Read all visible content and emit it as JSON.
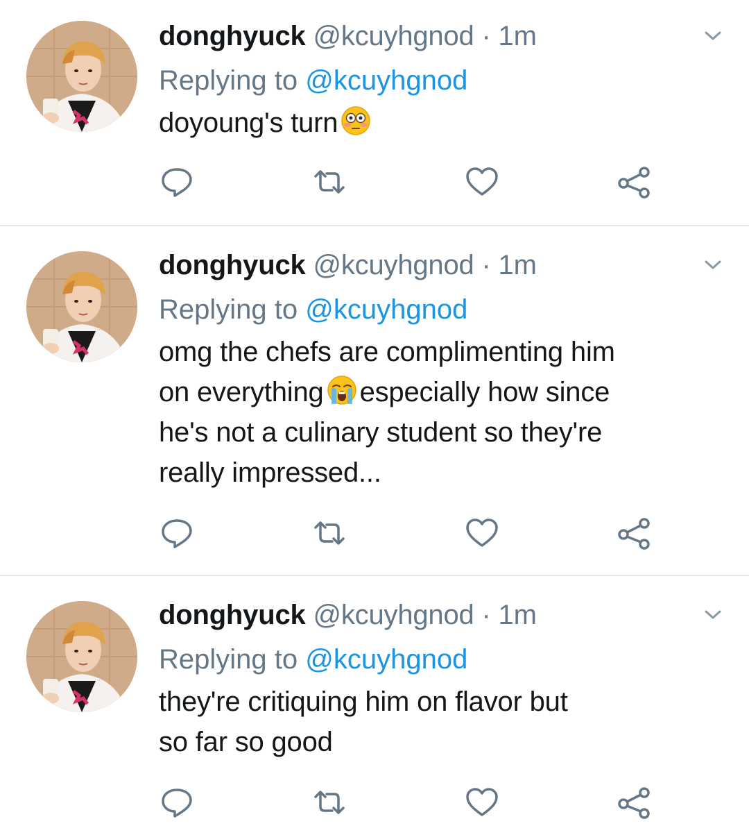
{
  "colors": {
    "text": "#14171a",
    "secondary": "#657786",
    "link": "#1b95e0",
    "divider": "#e1e8ed",
    "icon": "#657786"
  },
  "tweets": [
    {
      "display_name": "donghyuck",
      "handle": "@kcuyhgnod",
      "separator": "·",
      "time": "1m",
      "replying_prefix": "Replying to",
      "replying_handle": "@kcuyhgnod",
      "text_parts": [
        "doyoung's turn",
        ""
      ],
      "emoji": "flushed-face-emoji"
    },
    {
      "display_name": "donghyuck",
      "handle": "@kcuyhgnod",
      "separator": "·",
      "time": "1m",
      "replying_prefix": "Replying to",
      "replying_handle": "@kcuyhgnod",
      "text_parts": [
        "omg the chefs are complimenting him\non everything",
        "especially how since\nhe's not a culinary student so they're\nreally impressed..."
      ],
      "emoji": "loudly-crying-face-emoji"
    },
    {
      "display_name": "donghyuck",
      "handle": "@kcuyhgnod",
      "separator": "·",
      "time": "1m",
      "replying_prefix": "Replying to",
      "replying_handle": "@kcuyhgnod",
      "text_parts": [
        "they're critiquing him on flavor but\nso far so good",
        ""
      ],
      "emoji": ""
    }
  ],
  "action_icons": [
    "reply-icon",
    "retweet-icon",
    "like-icon",
    "share-icon"
  ]
}
